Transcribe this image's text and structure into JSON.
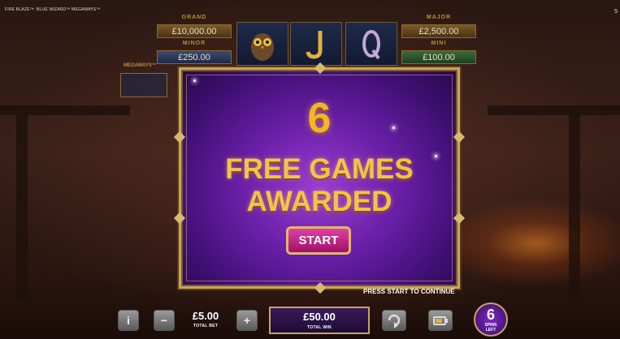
{
  "header": {
    "game_title": "FIRE BLAZE™: BLUE WIZARD™ MEGAWAYS™",
    "corner_number": "5"
  },
  "jackpots": {
    "grand": {
      "label": "GRAND",
      "value": "£10,000.00"
    },
    "minor": {
      "label": "MINOR",
      "value": "£250.00"
    },
    "major": {
      "label": "MAJOR",
      "value": "£2,500.00"
    },
    "mini": {
      "label": "MINI",
      "value": "£100.00"
    }
  },
  "reel_symbols": [
    "owl-symbol",
    "j-symbol",
    "q-symbol"
  ],
  "megaways": {
    "label": "MEGAWAYS™"
  },
  "popup": {
    "count": "6",
    "line1": "FREE GAMES",
    "line2": "AWARDED",
    "start_label": "START"
  },
  "prompt": "PRESS START TO CONTINUE",
  "controls": {
    "info_label": "i",
    "minus_label": "−",
    "plus_label": "+",
    "total_bet_value": "£5.00",
    "total_bet_caption": "TOTAL BET",
    "total_win_value": "£50.00",
    "total_win_caption": "TOTAL WIN",
    "spins_left_count": "6",
    "spins_left_caption_line1": "SPINS",
    "spins_left_caption_line2": "LEFT"
  },
  "colors": {
    "popup_purple": "#6a1fa8",
    "gold_text": "#f2c34a",
    "start_pink": "#c0208a",
    "frame_gold": "#c7a460"
  }
}
